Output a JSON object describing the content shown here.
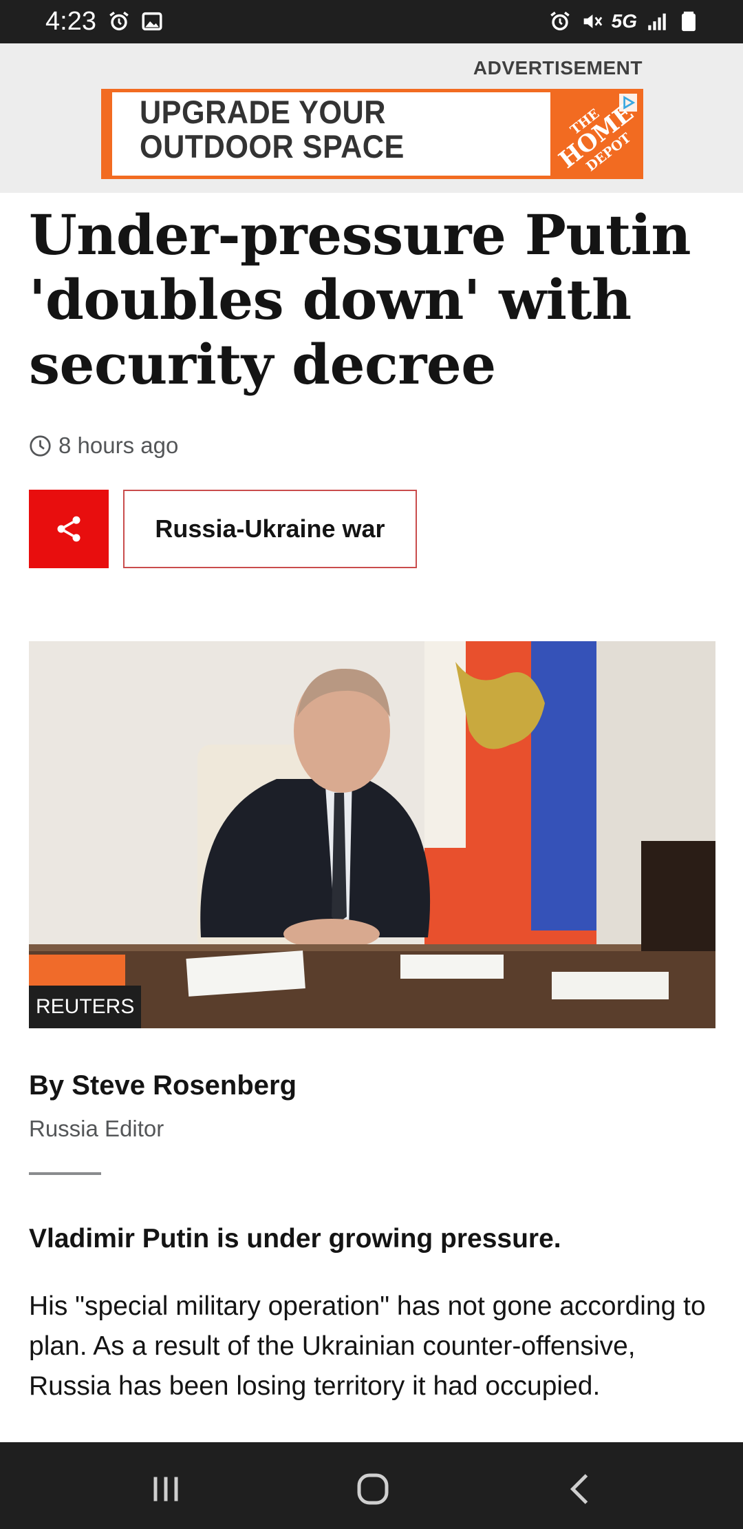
{
  "status_bar": {
    "time": "4:23",
    "network": "5G",
    "icons": [
      "alarm-icon",
      "gallery-icon",
      "alarm-icon",
      "mute-icon",
      "signal-icon",
      "battery-icon"
    ]
  },
  "ad": {
    "label": "ADVERTISEMENT",
    "headline_line1": "UPGRADE YOUR",
    "headline_line2": "OUTDOOR SPACE",
    "brand_logo": "THE HOME DEPOT",
    "accent_color": "#f26b21"
  },
  "article": {
    "headline": "Under-pressure Putin 'doubles down' with security decree",
    "timestamp": "8 hours ago",
    "topic": "Russia-Ukraine war",
    "image_credit": "REUTERS",
    "byline": "By Steve Rosenberg",
    "byline_role": "Russia Editor",
    "lead": "Vladimir Putin is under growing pressure.",
    "body": "His \"special military operation\" has not gone according to plan. As a result of the Ukrainian counter-offensive, Russia has been losing territory it had occupied."
  },
  "colors": {
    "share_red": "#e80e0e",
    "topic_border": "#c94c4c"
  },
  "nav_bar": {
    "buttons": [
      "recent-apps-icon",
      "home-icon",
      "back-icon"
    ]
  }
}
